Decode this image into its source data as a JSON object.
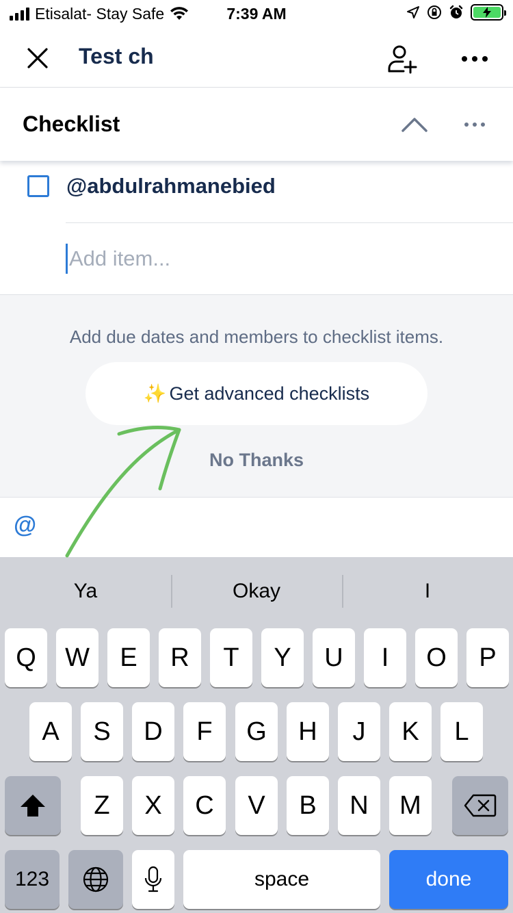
{
  "status_bar": {
    "carrier": "Etisalat- Stay Safe",
    "time": "7:39 AM"
  },
  "nav": {
    "title": "Test ch"
  },
  "checklist": {
    "title": "Checklist",
    "items": [
      {
        "text": "@abdulrahmanebied",
        "checked": false
      }
    ],
    "add_item_placeholder": "Add item..."
  },
  "upsell": {
    "message": "Add due dates and members to checklist items.",
    "cta_label": "Get advanced checklists",
    "cta_emoji": "✨",
    "dismiss_label": "No Thanks"
  },
  "mention_bar": {
    "mention_symbol": "@"
  },
  "keyboard": {
    "predictions": [
      "Ya",
      "Okay",
      "I"
    ],
    "row1": [
      "Q",
      "W",
      "E",
      "R",
      "T",
      "Y",
      "U",
      "I",
      "O",
      "P"
    ],
    "row2": [
      "A",
      "S",
      "D",
      "F",
      "G",
      "H",
      "J",
      "K",
      "L"
    ],
    "row3": [
      "Z",
      "X",
      "C",
      "V",
      "B",
      "N",
      "M"
    ],
    "numbers_label": "123",
    "space_label": "space",
    "done_label": "done"
  },
  "colors": {
    "accent": "#2d7bd6",
    "done_key": "#2f7cf6",
    "annotation_arrow": "#6abf5e"
  }
}
